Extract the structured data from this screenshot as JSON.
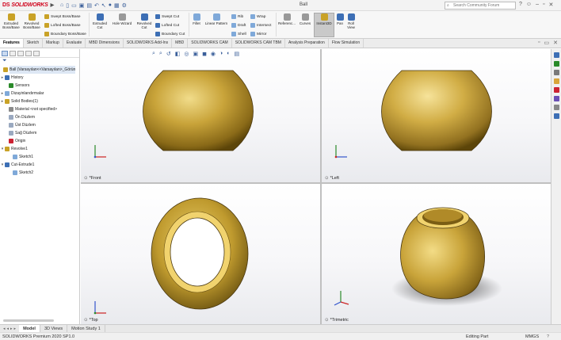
{
  "app": {
    "logo_brand": "DS",
    "logo_text": "SOLIDWORKS",
    "document_title": "Ball",
    "search_placeholder": "Search Community Forum"
  },
  "ribbon": {
    "extruded_boss": "Extruded Boss/Base",
    "revolved_boss": "Revolved Boss/Base",
    "swept_boss": "Swept Boss/Base",
    "lofted_boss": "Lofted Boss/Base",
    "boundary_boss": "Boundary Boss/Base",
    "extruded_cut": "Extruded Cut",
    "hole_wizard": "Hole Wizard",
    "revolved_cut": "Revolved Cut",
    "swept_cut": "Swept Cut",
    "lofted_cut": "Lofted Cut",
    "boundary_cut": "Boundary Cut",
    "fillet": "Fillet",
    "linear_pattern": "Linear Pattern",
    "rib": "Rib",
    "draft": "Draft",
    "shell": "Shell",
    "wrap": "Wrap",
    "intersect": "Intersect",
    "mirror": "Mirror",
    "reference": "Referenc...",
    "curves": "Curves",
    "instant3d": "Instant3D",
    "pan": "Pan",
    "roll_view": "Roll View"
  },
  "tabs": [
    "Features",
    "Sketch",
    "Markup",
    "Evaluate",
    "MBD Dimensions",
    "SOLIDWORKS Add-Ins",
    "MBD",
    "SOLIDWORKS CAM",
    "SOLIDWORKS CAM TBM",
    "Analysis Preparation",
    "Flow Simulation"
  ],
  "tree": [
    {
      "label": "Ball  (Varsayılan<<Varsayılan>_Görün",
      "twisty": "",
      "indent": 2
    },
    {
      "label": "History",
      "twisty": "▸",
      "indent": 4
    },
    {
      "label": "Sensors",
      "twisty": "",
      "indent": 9
    },
    {
      "label": "Dizayinlandırmalar",
      "twisty": "▸",
      "indent": 4
    },
    {
      "label": "Solid Bodies(1)",
      "twisty": "▸",
      "indent": 4
    },
    {
      "label": "Material <not specified>",
      "twisty": "",
      "indent": 9
    },
    {
      "label": "Ön Düzlem",
      "twisty": "",
      "indent": 9
    },
    {
      "label": "Üst Düzlem",
      "twisty": "",
      "indent": 9
    },
    {
      "label": "Sağ Düzlem",
      "twisty": "",
      "indent": 9
    },
    {
      "label": "Origin",
      "twisty": "",
      "indent": 9
    },
    {
      "label": "Revolve1",
      "twisty": "▾",
      "indent": 4
    },
    {
      "label": "Sketch1",
      "twisty": "",
      "indent": 14
    },
    {
      "label": "Cut-Extrude1",
      "twisty": "▾",
      "indent": 4
    },
    {
      "label": "Sketch2",
      "twisty": "",
      "indent": 14
    }
  ],
  "viewports": {
    "front": "*Front",
    "left": "*Left",
    "top": "*Top",
    "trimetric": "*Trimetric"
  },
  "bottom_tabs": [
    "Model",
    "3D Views",
    "Motion Study 1"
  ],
  "status": {
    "left": "SOLIDWORKS Premium 2020 SP1.0",
    "mode": "Editing Part",
    "units": "MMGS",
    "help": "?"
  },
  "colors": {
    "gold": "#b8952a",
    "gold_light": "#eed57a",
    "gold_dark": "#5c4509",
    "accent": "#3a5f9a",
    "logo_red": "#d0021b"
  }
}
